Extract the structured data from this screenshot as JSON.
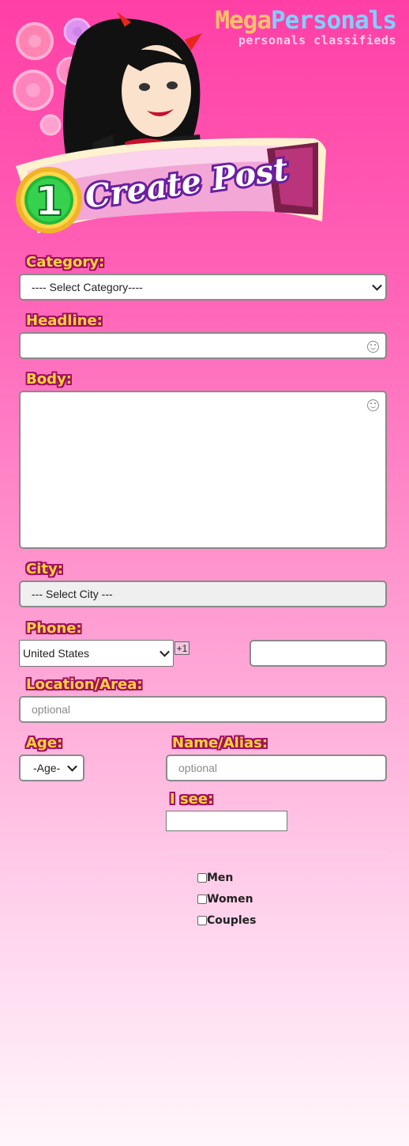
{
  "header": {
    "logo_part1": "Mega",
    "logo_part2": "Personals",
    "tagline": "personals classifieds",
    "step_number": "1",
    "banner_title": "Create Post"
  },
  "form": {
    "category": {
      "label": "Category:",
      "value": "---- Select Category----"
    },
    "headline": {
      "label": "Headline:",
      "value": ""
    },
    "body": {
      "label": "Body:",
      "value": ""
    },
    "city": {
      "label": "City:",
      "value": "--- Select City ---"
    },
    "phone": {
      "label": "Phone:",
      "country": "United States",
      "code": "+1",
      "number": ""
    },
    "location": {
      "label": "Location/Area:",
      "placeholder": "optional"
    },
    "age": {
      "label": "Age:",
      "value": "-Age-"
    },
    "name": {
      "label": "Name/Alias:",
      "placeholder": "optional"
    },
    "i_see": {
      "label": "I see:",
      "options": [
        "Men",
        "Women",
        "Couples"
      ]
    }
  },
  "colors": {
    "label_fill": "#ffd23b",
    "label_outline": "#a11166",
    "logo_orange": "#ffc06b",
    "logo_blue": "#7fd0ff"
  }
}
